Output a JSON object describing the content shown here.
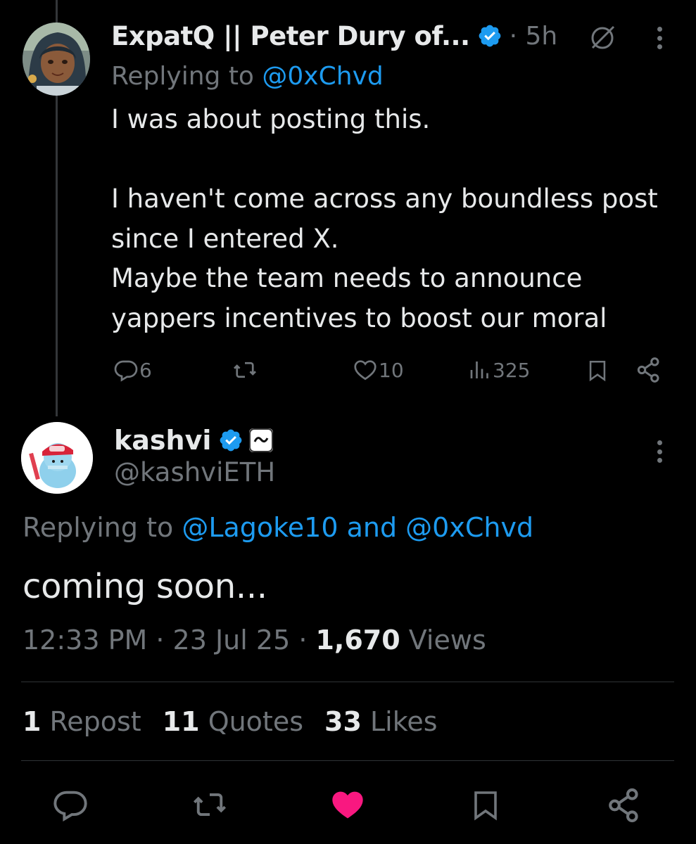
{
  "reply": {
    "author_name": "ExpatQ || Peter Dury of...",
    "time": "· 5h",
    "replying_prefix": "Replying to ",
    "replying_mention": "@0xChvd",
    "text": "I was about posting this.\n\nI haven't come across any boundless post since I entered X.\nMaybe the team needs to announce yappers incentives to boost our moral",
    "actions": {
      "replies": "6",
      "likes": "10",
      "views": "325"
    }
  },
  "main": {
    "author_name": "kashvi",
    "handle": "@kashviETH",
    "replying_prefix": "Replying to ",
    "replying_mentions": "@Lagoke10 and @0xChvd",
    "text": "coming soon...",
    "time": "12:33 PM · 23 Jul 25 · ",
    "views_count": "1,670",
    "views_label": " Views"
  },
  "stats": {
    "reposts_count": "1",
    "reposts_label": "Repost",
    "quotes_count": "11",
    "quotes_label": "Quotes",
    "likes_count": "33",
    "likes_label": "Likes"
  },
  "colors": {
    "background": "#000000",
    "text": "#e7e9ea",
    "muted": "#71767b",
    "accent": "#1d9bf0",
    "like_active": "#f91880"
  },
  "icons": [
    "verified-badge-icon",
    "grok-icon",
    "more-icon",
    "reply-icon",
    "repost-icon",
    "like-icon",
    "views-icon",
    "bookmark-icon",
    "share-icon",
    "affiliate-badge-icon"
  ]
}
